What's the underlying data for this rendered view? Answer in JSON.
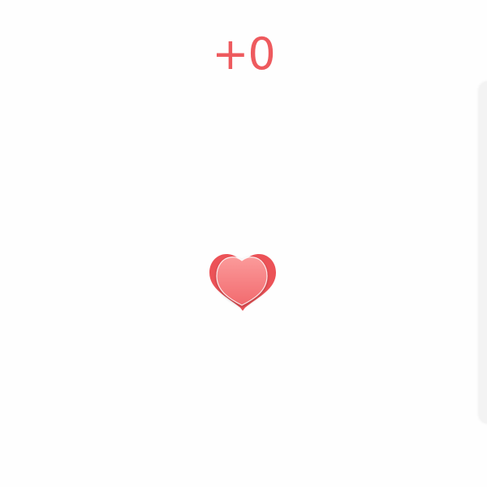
{
  "counter": {
    "text": "+0"
  },
  "colors": {
    "accent": "#ee5a5e",
    "heart_back": "#ec5257",
    "heart_front_top": "#fb9a9a",
    "heart_front_bottom": "#f26a6e",
    "panel_edge": "#f3f3f3"
  },
  "icons": {
    "like": "heart-icon"
  }
}
